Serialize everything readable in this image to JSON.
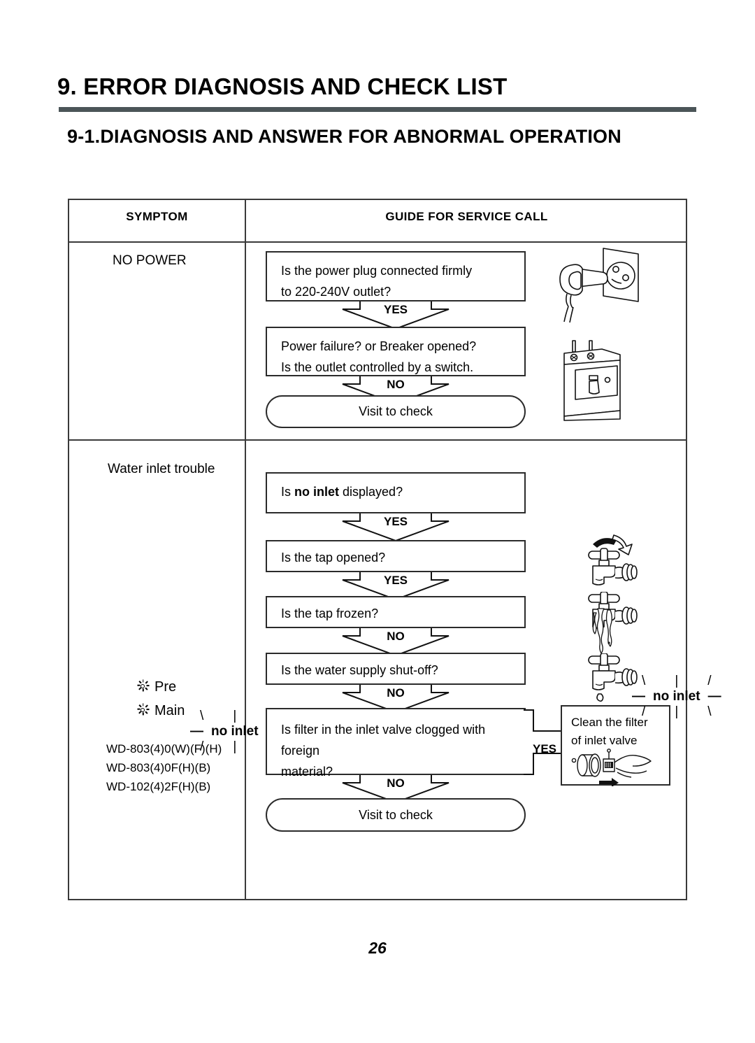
{
  "document": {
    "chapter_title": "9. ERROR DIAGNOSIS AND CHECK LIST",
    "section_title": "9-1.DIAGNOSIS AND ANSWER FOR ABNORMAL OPERATION",
    "page_number": "26",
    "rule_color": "#4b5558"
  },
  "table": {
    "headers": {
      "symptom": "SYMPTOM",
      "guide": "GUIDE FOR SERVICE CALL"
    },
    "rows": [
      {
        "symptom": {
          "label": "NO POWER"
        },
        "flow": {
          "steps": [
            {
              "text_line1": "Is the power plug connected firmly",
              "text_line2": "to  220-240V outlet?"
            },
            {
              "text_line1": "Power failure? or Breaker opened?",
              "text_line2": "Is the outlet controlled by a switch."
            }
          ],
          "connectors": [
            "YES",
            "NO"
          ],
          "terminal": "Visit to check"
        },
        "illustrations": [
          "power-plug-outlet-illustration",
          "circuit-breaker-illustration"
        ]
      },
      {
        "symptom": {
          "label": "Water inlet trouble",
          "indicator": {
            "text": "no inlet",
            "dash_left": "—",
            "dash_right": "—",
            "rays_top": [
              "\\",
              "|",
              "/"
            ],
            "rays_bottom": [
              "/",
              "|",
              "\\"
            ]
          },
          "lamps": [
            "Pre",
            "Main"
          ],
          "models": [
            "WD-803(4)0(W)(F)(H)",
            "WD-803(4)0F(H)(B)",
            "WD-102(4)2F(H)(B)"
          ]
        },
        "flow": {
          "steps": [
            {
              "prefix": "Is ",
              "bold": "no inlet",
              "suffix": " displayed?"
            },
            {
              "text_line1": "Is the tap opened?"
            },
            {
              "text_line1": "Is the tap frozen?"
            },
            {
              "text_line1": "Is the water supply shut-off?"
            },
            {
              "text_line1": "Is filter in the inlet valve clogged with foreign",
              "text_line2": "material?"
            }
          ],
          "connectors": [
            "YES",
            "YES",
            "NO",
            "NO",
            "NO"
          ],
          "branch": {
            "label": "YES",
            "target_line1": "Clean the filter",
            "target_line2": "of inlet valve"
          },
          "terminal": "Visit to check"
        },
        "illustrations": [
          "no-inlet-indicator",
          "tap-open-illustration",
          "tap-frozen-illustration",
          "tap-dripping-illustration",
          "inlet-valve-filter-cleaning-illustration"
        ]
      }
    ]
  }
}
